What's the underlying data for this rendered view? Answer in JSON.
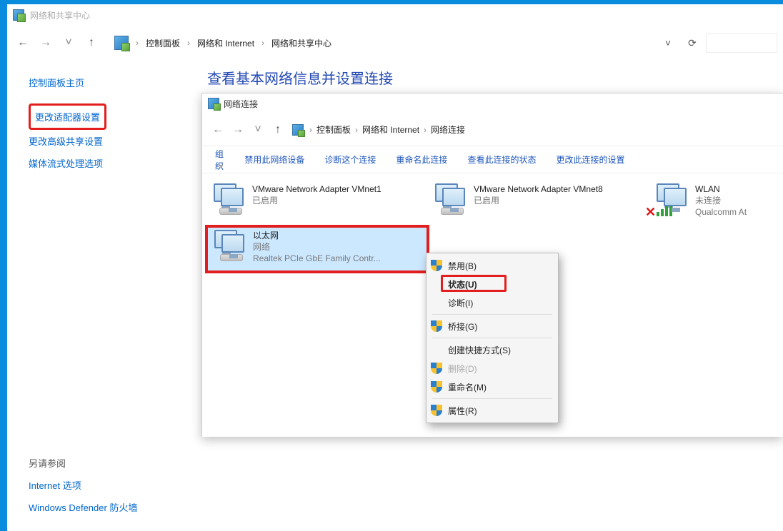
{
  "outer": {
    "title": "网络和共享中心",
    "breadcrumb": [
      "控制面板",
      "网络和 Internet",
      "网络和共享中心"
    ],
    "heading": "查看基本网络信息并设置连接"
  },
  "sidebar": {
    "home": "控制面板主页",
    "adapter_settings": "更改适配器设置",
    "advanced_sharing": "更改高级共享设置",
    "media_streaming": "媒体流式处理选项",
    "see_also": "另请参阅",
    "internet_options": "Internet 选项",
    "defender_firewall": "Windows Defender 防火墙"
  },
  "inner": {
    "title": "网络连接",
    "breadcrumb": [
      "控制面板",
      "网络和 Internet",
      "网络连接"
    ],
    "toolbar": {
      "organize": "组织",
      "disable": "禁用此网络设备",
      "diagnose": "诊断这个连接",
      "rename": "重命名此连接",
      "status": "查看此连接的状态",
      "settings": "更改此连接的设置"
    },
    "adapters": [
      {
        "name": "VMware Network Adapter VMnet1",
        "status": "已启用",
        "desc": "",
        "type": "vm"
      },
      {
        "name": "VMware Network Adapter VMnet8",
        "status": "已启用",
        "desc": "",
        "type": "vm"
      },
      {
        "name": "WLAN",
        "status": "未连接",
        "desc": "Qualcomm At",
        "type": "wifi"
      },
      {
        "name": "以太网",
        "status": "网络",
        "desc": "Realtek PCIe GbE Family Contr...",
        "type": "eth"
      }
    ]
  },
  "menu": {
    "disable": "禁用(B)",
    "status": "状态(U)",
    "diagnose": "诊断(I)",
    "bridge": "桥接(G)",
    "shortcut": "创建快捷方式(S)",
    "delete": "删除(D)",
    "rename": "重命名(M)",
    "properties": "属性(R)"
  }
}
